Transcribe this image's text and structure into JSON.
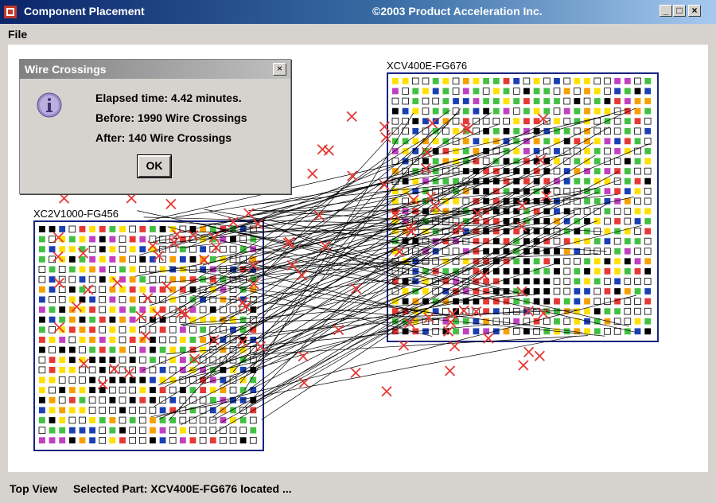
{
  "window": {
    "title": "Component Placement",
    "copyright": "©2003 Product Acceleration Inc.",
    "minimize_label": "_",
    "maximize_label": "□",
    "close_label": "×"
  },
  "menu": {
    "file_label": "File"
  },
  "canvas": {
    "chip_small_label": "XC2V1000-FG456",
    "chip_large_label": "XCV400E-FG676",
    "colors": {
      "border": "#1a237e",
      "wire": "#000000",
      "crossing": "#e53935",
      "pin_black": "#000000",
      "pin_red": "#e53935",
      "pin_green": "#43c043",
      "pin_blue": "#1a3fb4",
      "pin_yellow": "#ffe000",
      "pin_orange": "#f5a000",
      "pin_magenta": "#c040c0"
    }
  },
  "dialog": {
    "title": "Wire Crossings",
    "close_label": "×",
    "line1": "Elapsed time: 4.42 minutes.",
    "line2": "Before: 1990 Wire Crossings",
    "line3": "After: 140 Wire Crossings",
    "ok_label": "OK",
    "icon": "info-icon"
  },
  "status": {
    "view": "Top View",
    "selection": "Selected Part: XCV400E-FG676 located ..."
  }
}
